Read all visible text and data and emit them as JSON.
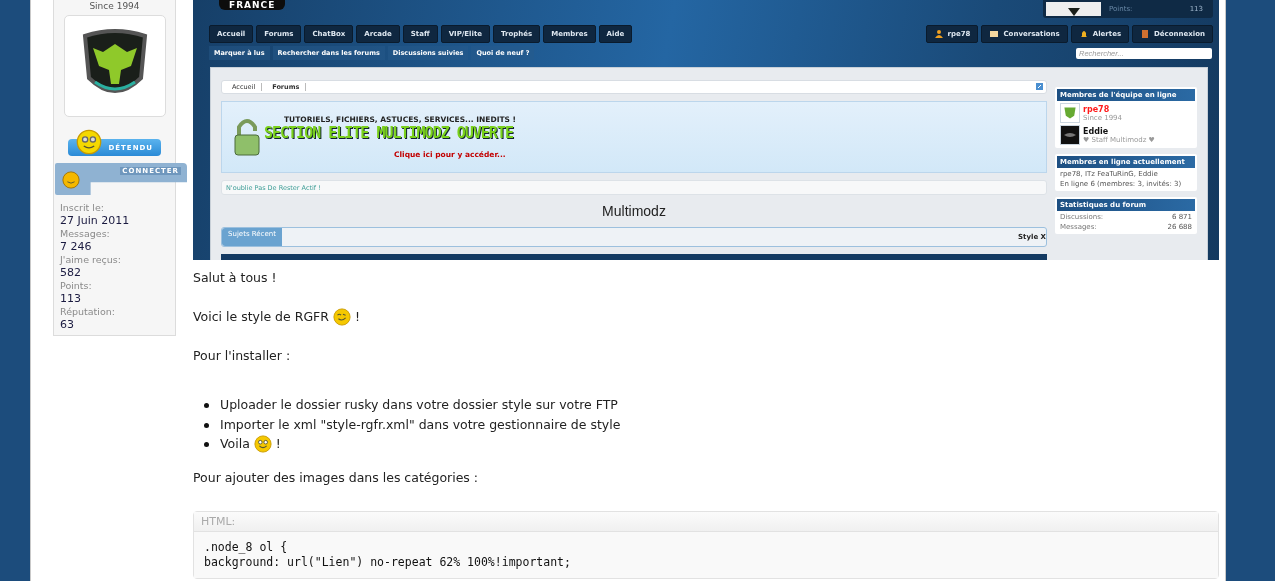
{
  "user_panel": {
    "since": "Since 1994",
    "mood": "DÉTENDU",
    "status": "CONNECTER",
    "stats": [
      {
        "label": "Inscrit le:",
        "value": "27 Juin 2011"
      },
      {
        "label": "Messages:",
        "value": "7 246"
      },
      {
        "label": "J'aime reçus:",
        "value": "582"
      },
      {
        "label": "Points:",
        "value": "113"
      },
      {
        "label": "Réputation:",
        "value": "63"
      }
    ]
  },
  "screenshot": {
    "logo": "FRANCE",
    "profile_stat": {
      "label": "Points:",
      "value": "113"
    },
    "nav": [
      "Accueil",
      "Forums",
      "ChatBox",
      "Arcade",
      "Staff",
      "VIP/Elite",
      "Trophés",
      "Membres",
      "Aide"
    ],
    "subnav": [
      "Marquer à lus",
      "Rechercher dans les forums",
      "Discussions suivies",
      "Quoi de neuf ?"
    ],
    "user_nav": [
      "rpe78",
      "Conversations",
      "Alertes",
      "Déconnexion"
    ],
    "search": {
      "placeholder": "Rechercher..."
    },
    "breadcrumb": [
      "Accueil",
      "Forums"
    ],
    "banner": {
      "tagline": "TUTORIELS, FICHIERS, ASTUCES, SERVICES... INEDITS !",
      "title": "SECTION ELITE MULTIMODZ OUVERTE",
      "link": "Clique ici pour y accéder..."
    },
    "notice": "N'oublie Pas De Rester Actif !",
    "title": "Multimodz",
    "tabs": [
      {
        "label": "Sujets Récent",
        "selected": true
      }
    ],
    "tab_right": "Style X",
    "staff": {
      "title": "Membres de l'équipe en ligne",
      "members": [
        {
          "name": "rpe78",
          "subtitle": "Since 1994",
          "color": "#ff1a1a"
        },
        {
          "name": "Eddie",
          "subtitle": "♥ Staff Multimodz ♥",
          "color": "#111111"
        }
      ]
    },
    "online": {
      "title": "Membres en ligne actuellement",
      "names": "rpe78, ITz FeaTuRinG, Eddie",
      "count": "En ligne 6 (membres: 3, invités: 3)"
    },
    "stats": {
      "title": "Statistiques du forum",
      "rows": [
        {
          "label": "Discussions:",
          "value": "6 871"
        },
        {
          "label": "Messages:",
          "value": "26 688"
        }
      ]
    }
  },
  "body": [
    {
      "kind": "paragraph",
      "text": "Salut à tous !"
    },
    {
      "kind": "paragraph",
      "text": "Voici le style de RGFR",
      "emoticon": {
        "kind": "wink"
      },
      "after": "!"
    },
    {
      "kind": "paragraph",
      "text": "Pour l'installer :"
    },
    {
      "kind": "list",
      "items": [
        {
          "text": "Uploader le dossier rusky dans votre dossier style sur votre FTP"
        },
        {
          "text": "Importer le xml \"style-rgfr.xml\" dans votre gestionnaire de style"
        },
        {
          "text": "Voila",
          "emoticon": {
            "kind": "grin"
          },
          "after": "!"
        }
      ]
    },
    {
      "kind": "paragraph",
      "text": "Pour ajouter des images dans les catégories :"
    },
    {
      "kind": "code",
      "label": "HTML:",
      "lines": [
        ".node_8 ol {",
        "background: url(\"Lien\") no-repeat 62% 100%!important;"
      ]
    }
  ]
}
